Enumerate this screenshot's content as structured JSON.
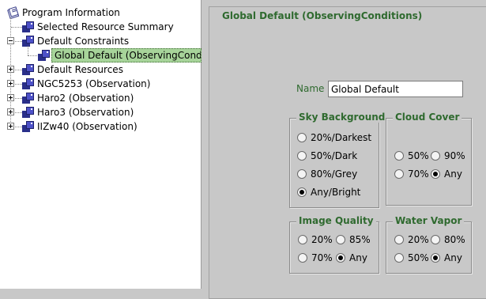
{
  "tree": {
    "root": "Program Information",
    "items": [
      {
        "label": "Selected Resource Summary"
      },
      {
        "label": "Default Constraints"
      },
      {
        "label": "Global Default (ObservingConditions)"
      },
      {
        "label": "Default Resources"
      },
      {
        "label": "NGC5253 (Observation)"
      },
      {
        "label": "Haro2 (Observation)"
      },
      {
        "label": "Haro3 (Observation)"
      },
      {
        "label": "IIZw40 (Observation)"
      }
    ]
  },
  "editor": {
    "title": "Global Default (ObservingConditions)",
    "name_label": "Name",
    "name_value": "Global Default",
    "sky_background": {
      "title": "Sky Background",
      "options": [
        "20%/Darkest",
        "50%/Dark",
        "80%/Grey",
        "Any/Bright"
      ],
      "selected": "Any/Bright"
    },
    "cloud_cover": {
      "title": "Cloud Cover",
      "options": [
        "50%",
        "90%",
        "70%",
        "Any"
      ],
      "selected": "Any"
    },
    "image_quality": {
      "title": "Image Quality",
      "options": [
        "20%",
        "85%",
        "70%",
        "Any"
      ],
      "selected": "Any"
    },
    "water_vapor": {
      "title": "Water Vapor",
      "options": [
        "20%",
        "80%",
        "50%",
        "Any"
      ],
      "selected": "Any"
    }
  },
  "colors": {
    "label_green": "#2f6a2f",
    "selection_green": "#a7d49a",
    "panel_gray": "#c8c8c8",
    "node_blue": "#4d51c8"
  }
}
